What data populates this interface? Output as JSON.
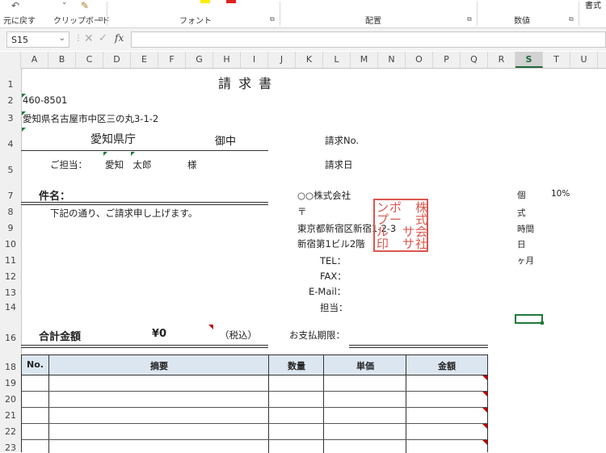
{
  "ribbon": {
    "undo_label": "元に戻す",
    "clipboard_label": "クリップボード",
    "font_label": "フォント",
    "align_label": "配置",
    "number_label": "数値",
    "style_label": "書式"
  },
  "formula_bar": {
    "name_box": "S15",
    "fx": "fx",
    "formula": ""
  },
  "columns": [
    "A",
    "B",
    "C",
    "D",
    "E",
    "F",
    "G",
    "H",
    "I",
    "J",
    "K",
    "L",
    "M",
    "N",
    "O",
    "P",
    "Q",
    "R",
    "S",
    "T",
    "U"
  ],
  "rows": [
    "1",
    "2",
    "3",
    "4",
    "5",
    "7",
    "8",
    "9",
    "10",
    "11",
    "12",
    "13",
    "14",
    "16",
    "18",
    "19",
    "20",
    "21",
    "22",
    "23"
  ],
  "invoice": {
    "title": "請 求 書",
    "postal": "460-8501",
    "address": "愛知県名古屋市中区三の丸3-1-2",
    "client": "愛知県庁",
    "onchu": "御中",
    "tanto_label": "ご担当：",
    "tanto_name": "愛知　太郎",
    "sama": "様",
    "invoice_no_label": "請求No.",
    "invoice_date_label": "請求日",
    "subject_label": "件名：",
    "message": "下記の通り、ご請求申し上げます。",
    "company": "○○株式会社",
    "postal_mark": "〒",
    "company_address": "東京都新宿区新宿1-2-3",
    "building": "新宿第1ビル2階",
    "tel": "TEL：",
    "fax": "FAX：",
    "email": "E-Mail：",
    "tanto2": "担当：",
    "total_label": "合計金額",
    "total_value": "¥0",
    "tax": "（税込）",
    "due_label": "お支払期限：",
    "stamp_chars": [
      "株",
      "ン",
      "ポ",
      "式",
      "プ",
      "ー",
      "会",
      "ル",
      "サ",
      "社",
      "印",
      "サ"
    ],
    "side_units": [
      "個",
      "式",
      "時間",
      "日",
      "ヶ月"
    ],
    "tax_rate": "10%"
  },
  "table": {
    "headers": [
      "No.",
      "摘要",
      "数量",
      "単価",
      "金額"
    ]
  }
}
